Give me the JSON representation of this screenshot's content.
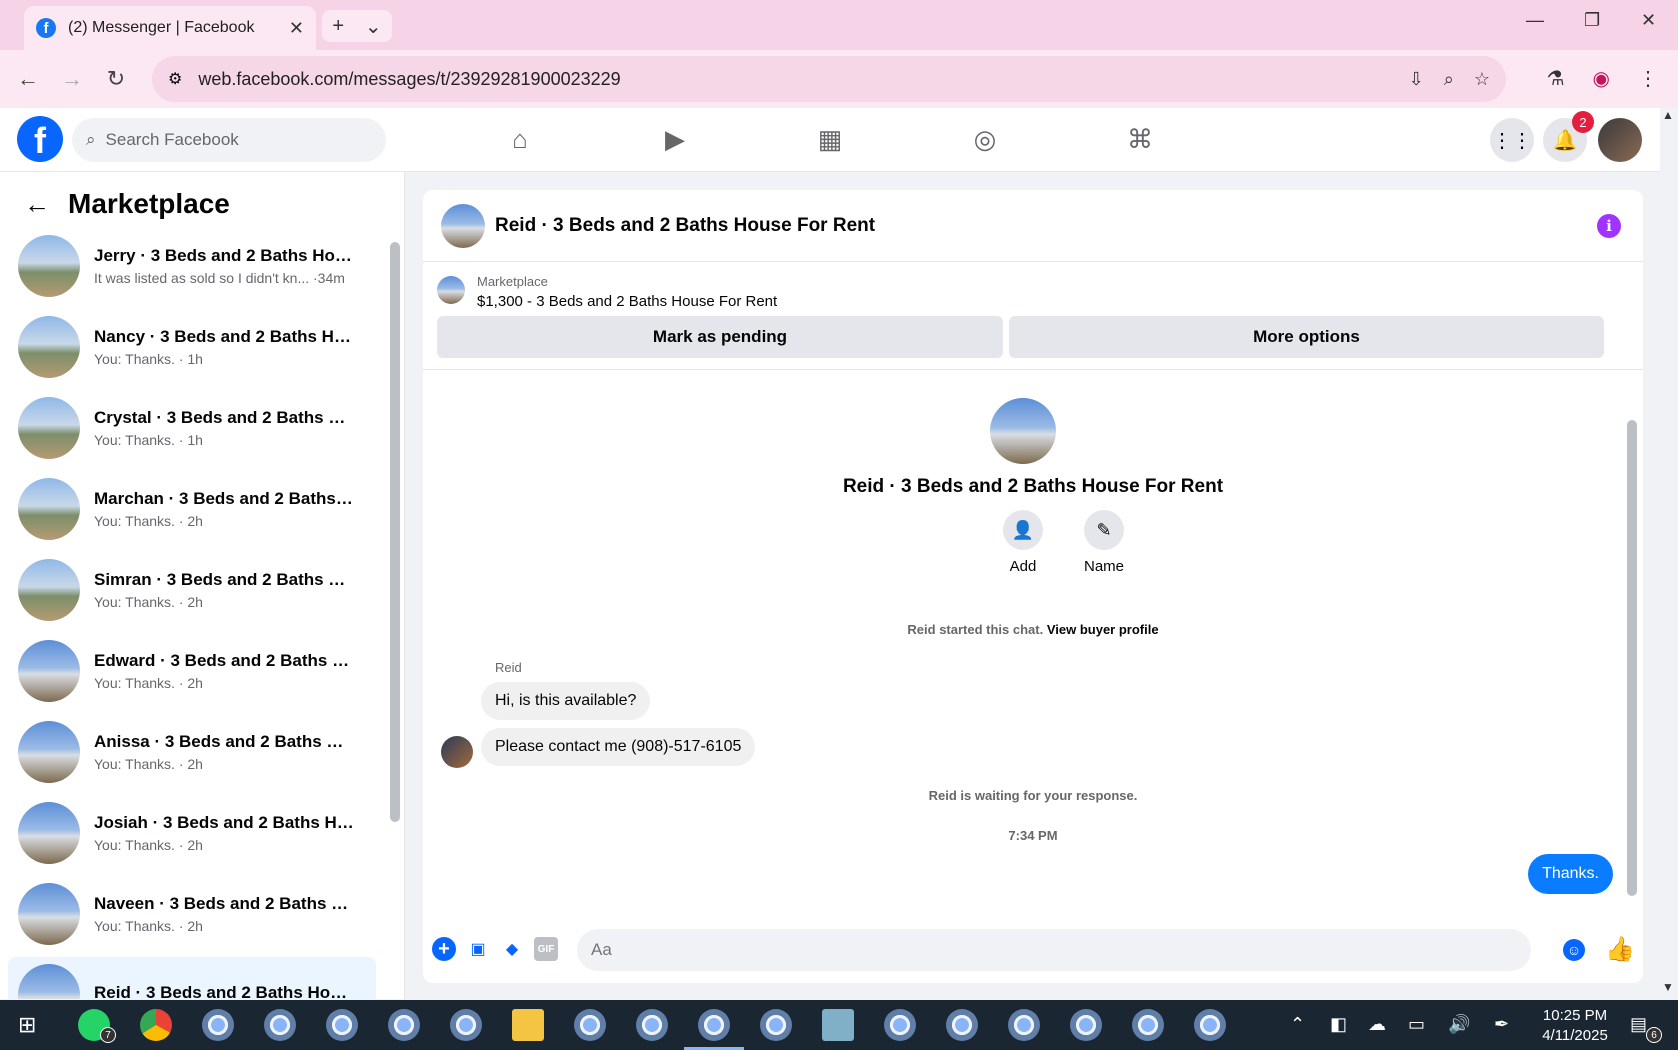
{
  "browser": {
    "tab_title": "(2) Messenger | Facebook",
    "url": "web.facebook.com/messages/t/23929281900023229"
  },
  "fb": {
    "search_placeholder": "Search Facebook",
    "notif_count": "2"
  },
  "left": {
    "title": "Marketplace",
    "conversations": [
      {
        "name": "Jerry · 3 Beds and 2 Baths Hous...",
        "preview": "It was listed as sold so I didn't kn... ·34m"
      },
      {
        "name": "Nancy · 3 Beds and 2 Baths Hou...",
        "preview": "You: Thanks. · 1h"
      },
      {
        "name": "Crystal · 3 Beds and 2 Baths Ho...",
        "preview": "You: Thanks. · 1h"
      },
      {
        "name": "Marchan · 3 Beds and 2 Baths H...",
        "preview": "You: Thanks. · 2h"
      },
      {
        "name": "Simran · 3 Beds and 2 Baths Ho...",
        "preview": "You: Thanks. · 2h"
      },
      {
        "name": "Edward · 3 Beds and 2 Baths Ho...",
        "preview": "You: Thanks. · 2h"
      },
      {
        "name": "Anissa · 3 Beds and 2 Baths Hou...",
        "preview": "You: Thanks. · 2h"
      },
      {
        "name": "Josiah · 3 Beds and 2 Baths Hou...",
        "preview": "You: Thanks. · 2h"
      },
      {
        "name": "Naveen · 3 Beds and 2 Baths Ho...",
        "preview": "You: Thanks. · 2h"
      },
      {
        "name": "Reid · 3 Beds and 2 Baths House...",
        "preview": ""
      }
    ]
  },
  "chat": {
    "header_name": "Reid · 3 Beds and 2 Baths House For Rent",
    "marketplace_label": "Marketplace",
    "listing": "$1,300 - 3 Beds and 2 Baths House For Rent",
    "mark_pending": "Mark as pending",
    "more_options": "More options",
    "center_name": "Reid · 3 Beds and 2 Baths House For Rent",
    "add_label": "Add",
    "name_label": "Name",
    "started_text": "Reid started this chat.",
    "view_profile": "View buyer profile",
    "sender": "Reid",
    "msg1": "Hi, is this available?",
    "msg2": "Please contact me (908)-517-6105",
    "waiting": "Reid is waiting for your response.",
    "time": "7:34 PM",
    "msg_out": "Thanks.",
    "composer_placeholder": "Aa"
  },
  "taskbar": {
    "time": "10:25 PM",
    "date": "4/11/2025",
    "whatsapp_badge": "7",
    "notif_badge": "6"
  }
}
